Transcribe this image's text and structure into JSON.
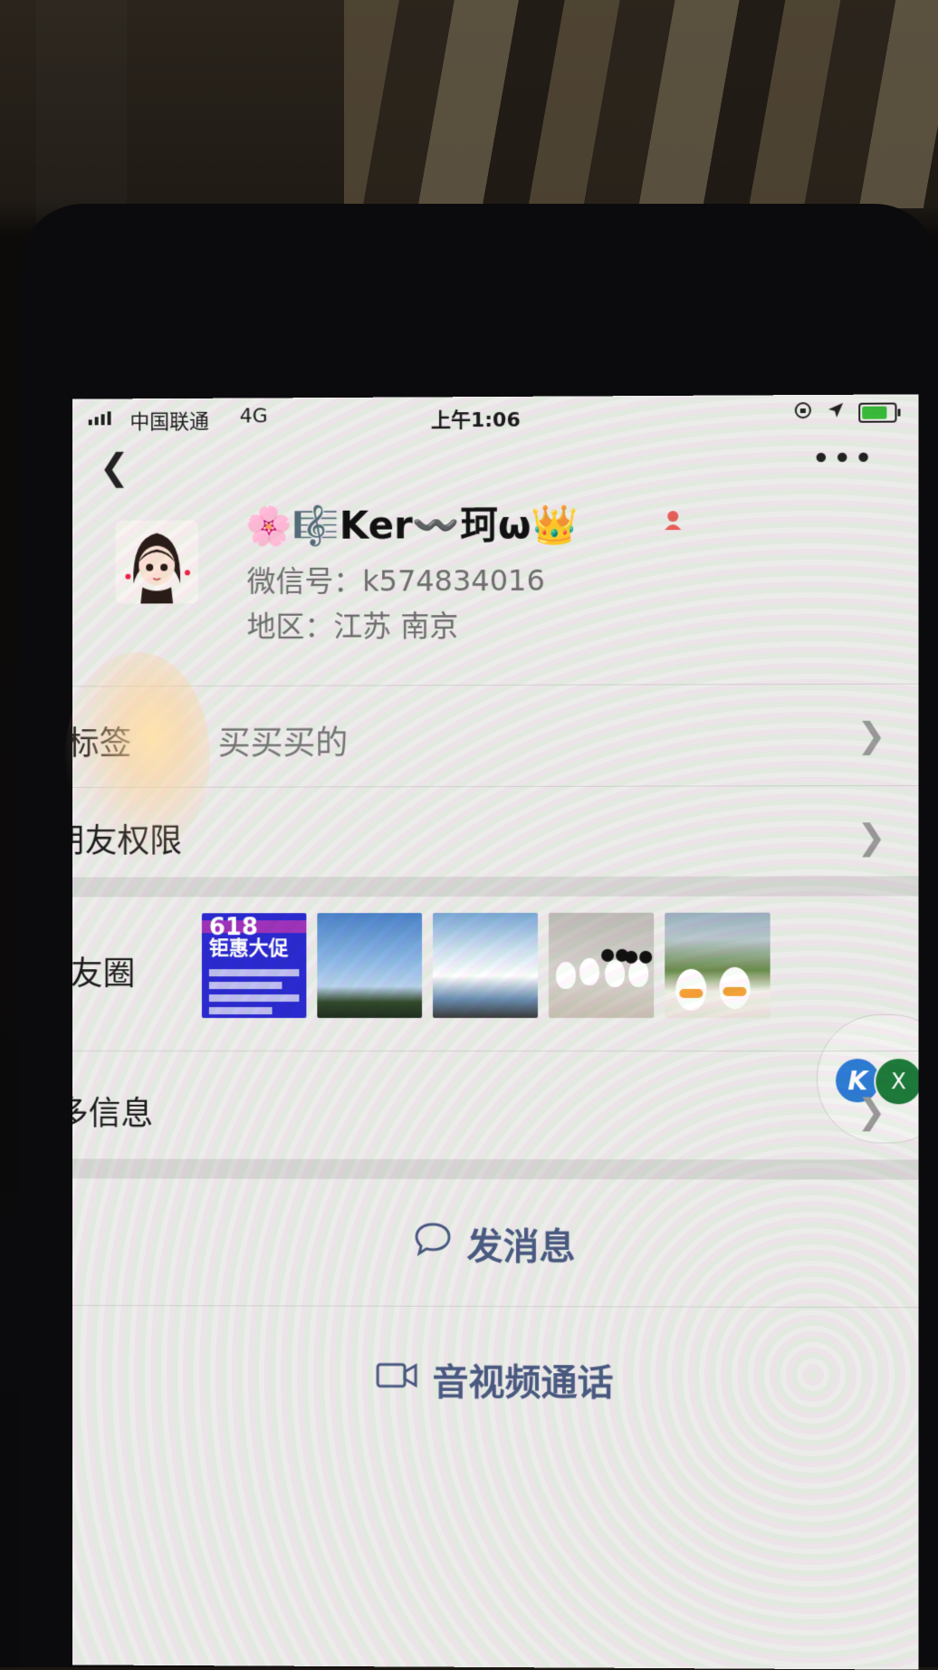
{
  "status_bar": {
    "carrier": "中国联通",
    "network": "4G",
    "time": "上午1:06",
    "battery_level": 0.8
  },
  "nav": {
    "back_icon": "chevron-left-icon",
    "more_icon": "ellipsis-icon"
  },
  "profile": {
    "nickname": "🌸🎼Ker〰️珂ω👑",
    "wechat_id": "微信号：k574834016",
    "region": "地区：江苏 南京"
  },
  "rows": {
    "tags": {
      "label": "标签",
      "value": "买买买的"
    },
    "friend_permissions": {
      "label": "朋友权限"
    },
    "moments": {
      "label": "朋友圈"
    },
    "more_info": {
      "label": "更多信息"
    }
  },
  "moments_thumbs": {
    "promo_line1": "618",
    "promo_line2": "钜惠大促"
  },
  "floating": {
    "bubble_k": "K",
    "bubble_x": "X"
  },
  "actions": {
    "send_message": "发消息",
    "video_call": "音视频通话"
  },
  "colors": {
    "accent_link": "#4a5a82",
    "battery_green": "#3aba3a"
  }
}
